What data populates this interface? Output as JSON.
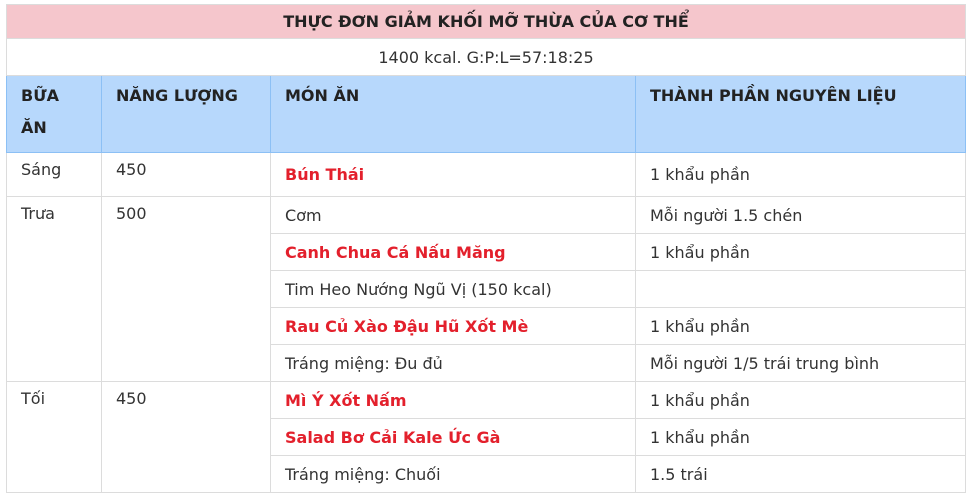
{
  "title": "THỰC ĐƠN GIẢM KHỐI MỠ THỪA CỦA CƠ THỂ",
  "subtitle": "1400 kcal. G:P:L=57:18:25",
  "headers": [
    "BỮA ĂN",
    "NĂNG LƯỢNG",
    "MÓN ĂN",
    "THÀNH PHẦN NGUYÊN LIỆU"
  ],
  "link_color": "#e3202c",
  "meals": [
    {
      "meal": "Sáng",
      "energy": "450",
      "dishes": [
        {
          "name": "Bún Thái",
          "link": true,
          "ingredients": "1 khẩu phần"
        }
      ]
    },
    {
      "meal": "Trưa",
      "energy": "500",
      "dishes": [
        {
          "name": "Cơm",
          "link": false,
          "ingredients": "Mỗi người 1.5 chén"
        },
        {
          "name": "Canh Chua Cá Nấu Măng",
          "link": true,
          "ingredients": "1 khẩu phần"
        },
        {
          "name": "Tim Heo Nướng Ngũ Vị (150 kcal)",
          "link": false,
          "ingredients": ""
        },
        {
          "name": "Rau Củ Xào Đậu Hũ Xốt Mè",
          "link": true,
          "ingredients": "1 khẩu phần"
        },
        {
          "name": "Tráng miệng: Đu đủ",
          "link": false,
          "ingredients": "Mỗi người 1/5 trái trung bình"
        }
      ]
    },
    {
      "meal": "Tối",
      "energy": "450",
      "dishes": [
        {
          "name": "Mì Ý Xốt Nấm",
          "link": true,
          "ingredients": "1 khẩu phần"
        },
        {
          "name": "Salad Bơ Cải Kale Ức Gà",
          "link": true,
          "ingredients": "1 khẩu phần"
        },
        {
          "name": "Tráng miệng: Chuối",
          "link": false,
          "ingredients": "1.5 trái"
        }
      ]
    }
  ]
}
